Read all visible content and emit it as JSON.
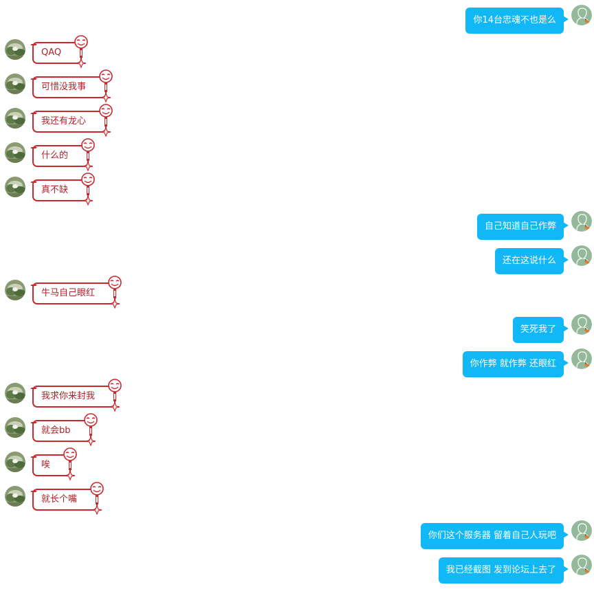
{
  "messages": [
    {
      "side": "right",
      "text": "你14台忠魂不也是么"
    },
    {
      "side": "left",
      "text": "QAQ"
    },
    {
      "side": "left",
      "text": "可惜没我事"
    },
    {
      "side": "left",
      "text": "我还有龙心"
    },
    {
      "side": "left",
      "text": "什么的"
    },
    {
      "side": "left",
      "text": "真不缺"
    },
    {
      "side": "right",
      "text": "自己知道自己作弊"
    },
    {
      "side": "right",
      "text": "还在这说什么"
    },
    {
      "side": "left",
      "text": "牛马自己眼红"
    },
    {
      "side": "right",
      "text": "笑死我了"
    },
    {
      "side": "right",
      "text": "你作弊 就作弊 还眼红"
    },
    {
      "side": "left",
      "text": "我求你来封我"
    },
    {
      "side": "left",
      "text": "就会bb"
    },
    {
      "side": "left",
      "text": "唉"
    },
    {
      "side": "left",
      "text": "就长个嘴"
    },
    {
      "side": "right",
      "text": "你们这个服务器 留着自己人玩吧"
    },
    {
      "side": "right",
      "text": "我已经截图 发到论坛上去了"
    }
  ],
  "colors": {
    "left_bubble_border": "#c9282d",
    "left_bubble_text": "#b4202a",
    "right_bubble_bg": "#12b7f5",
    "right_bubble_text": "#ffffff"
  },
  "icons": {
    "left_avatar": "user-avatar-photo-icon",
    "right_avatar": "user-avatar-sketch-icon",
    "bubble_deco": "smiley-face-ornament-icon"
  }
}
